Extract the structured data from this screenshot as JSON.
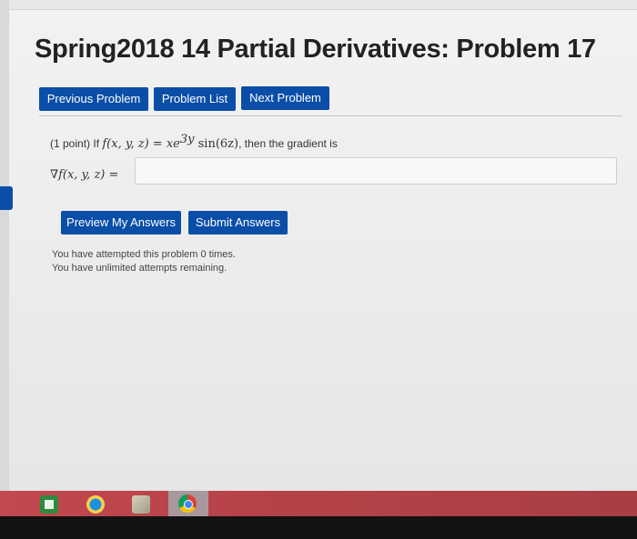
{
  "page": {
    "title": "Spring2018 14 Partial Derivatives: Problem 17"
  },
  "nav": {
    "previous_label": "Previous Problem",
    "list_label": "Problem List",
    "next_label": "Next Problem"
  },
  "problem": {
    "points": "(1 point) If",
    "func": "f(x, y, z)",
    "equals": " = ",
    "expr_x": "xe",
    "expr_exp": "3y",
    "expr_sin": " sin(6z)",
    "tail": ", then the gradient is",
    "gradient_label": "∇f(x, y, z) =",
    "answer_value": ""
  },
  "actions": {
    "preview_label": "Preview My Answers",
    "submit_label": "Submit Answers"
  },
  "status": {
    "attempted": "You have attempted this problem 0 times.",
    "remaining": "You have unlimited attempts remaining."
  },
  "colors": {
    "button_blue": "#0a4ea8",
    "taskbar": "#b74249"
  },
  "taskbar": {
    "icons": [
      "store-icon",
      "media-player-icon",
      "photos-icon",
      "chrome-icon"
    ]
  }
}
